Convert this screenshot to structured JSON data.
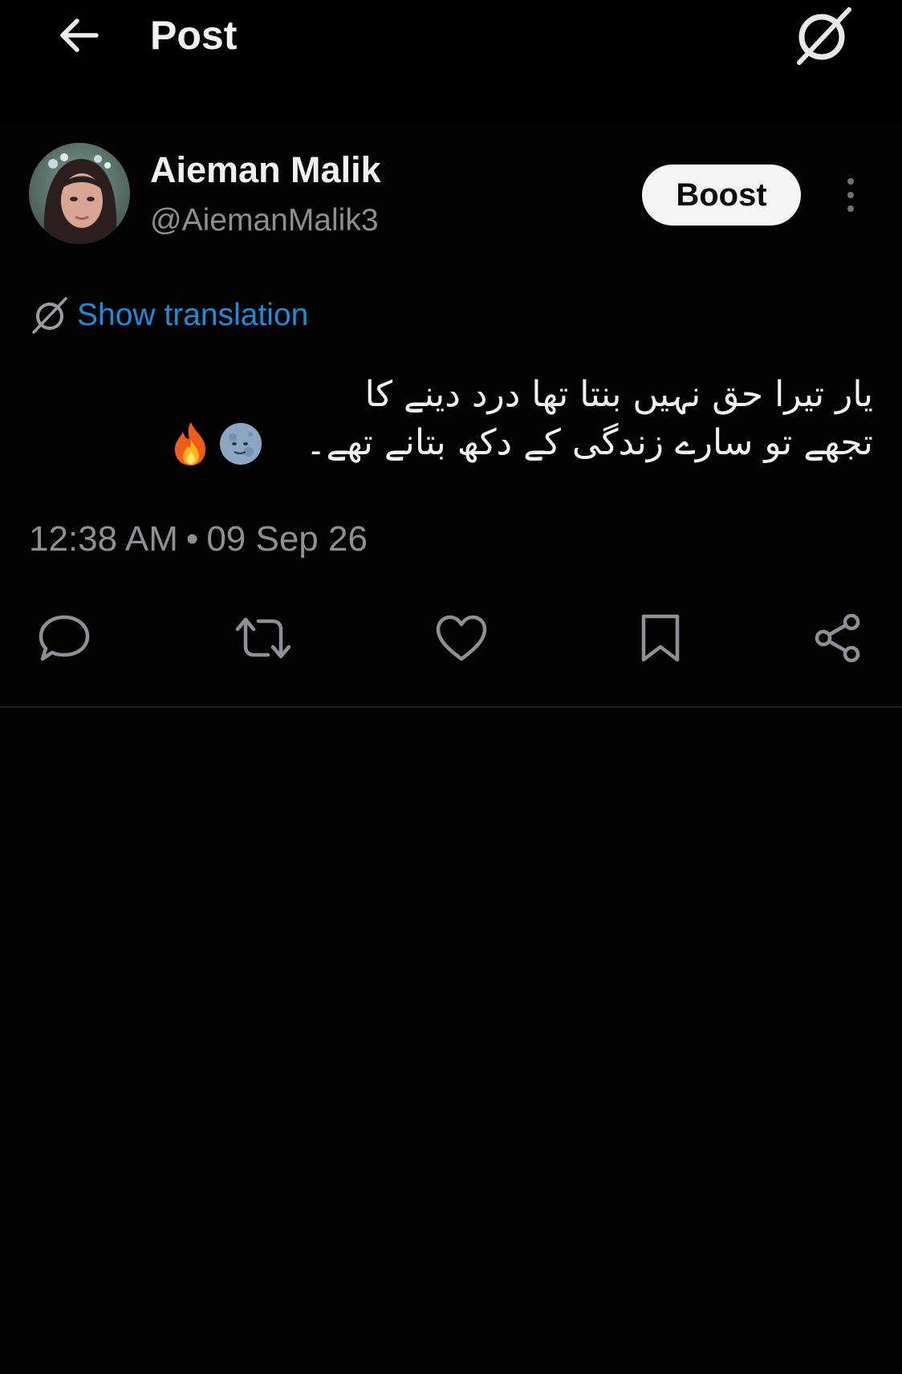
{
  "header": {
    "title": "Post",
    "back_icon": "arrow-left-icon",
    "logo_icon": "slashed-circle-logo-icon"
  },
  "author": {
    "display_name": "Aieman Malik",
    "handle": "@AiemanMalik3",
    "boost_label": "Boost"
  },
  "translation": {
    "label": "Show translation",
    "link_color": "#1f8bd9"
  },
  "post": {
    "lines": [
      "یار تیرا حق نہیں بنتا تھا درد دینے کا",
      "تجھے تو سارے زندگی کے دکھ بتانے تھے۔"
    ],
    "emojis": [
      "moon-face-emoji",
      "fire-emoji"
    ]
  },
  "meta": {
    "time": "12:38 AM",
    "separator": "•",
    "date": "09 Sep 26"
  },
  "actions": {
    "icons": [
      "reply-icon",
      "repost-icon",
      "like-icon",
      "bookmark-icon",
      "share-icon"
    ]
  },
  "colors": {
    "background": "#030303",
    "text_primary": "#f2f2f2",
    "text_secondary": "#8d9196",
    "boost_bg": "#f4f4f4"
  }
}
